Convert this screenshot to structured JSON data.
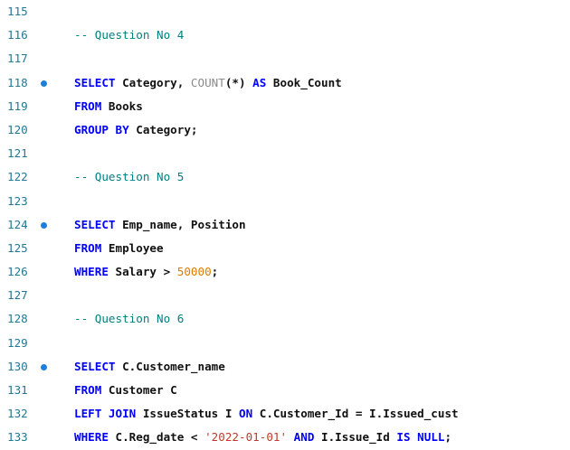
{
  "editor": {
    "lines": [
      {
        "n": "115",
        "bp": false,
        "tokens": []
      },
      {
        "n": "116",
        "bp": false,
        "tokens": [
          {
            "t": "cm",
            "v": "-- Question No 4"
          }
        ]
      },
      {
        "n": "117",
        "bp": false,
        "tokens": []
      },
      {
        "n": "118",
        "bp": true,
        "tokens": [
          {
            "t": "kw",
            "v": "SELECT"
          },
          {
            "t": "tx",
            "v": " Category, "
          },
          {
            "t": "fn",
            "v": "COUNT"
          },
          {
            "t": "tx",
            "v": "(*) "
          },
          {
            "t": "kw",
            "v": "AS"
          },
          {
            "t": "tx",
            "v": " Book_Count"
          }
        ]
      },
      {
        "n": "119",
        "bp": false,
        "tokens": [
          {
            "t": "kw",
            "v": "FROM"
          },
          {
            "t": "tx",
            "v": " Books"
          }
        ]
      },
      {
        "n": "120",
        "bp": false,
        "tokens": [
          {
            "t": "kw",
            "v": "GROUP BY"
          },
          {
            "t": "tx",
            "v": " Category;"
          }
        ]
      },
      {
        "n": "121",
        "bp": false,
        "tokens": []
      },
      {
        "n": "122",
        "bp": false,
        "tokens": [
          {
            "t": "cm",
            "v": "-- Question No 5"
          }
        ]
      },
      {
        "n": "123",
        "bp": false,
        "tokens": []
      },
      {
        "n": "124",
        "bp": true,
        "tokens": [
          {
            "t": "kw",
            "v": "SELECT"
          },
          {
            "t": "tx",
            "v": " Emp_name, Position"
          }
        ]
      },
      {
        "n": "125",
        "bp": false,
        "tokens": [
          {
            "t": "kw",
            "v": "FROM"
          },
          {
            "t": "tx",
            "v": " Employee"
          }
        ]
      },
      {
        "n": "126",
        "bp": false,
        "tokens": [
          {
            "t": "kw",
            "v": "WHERE"
          },
          {
            "t": "tx",
            "v": " Salary > "
          },
          {
            "t": "num",
            "v": "50000"
          },
          {
            "t": "tx",
            "v": ";"
          }
        ]
      },
      {
        "n": "127",
        "bp": false,
        "tokens": []
      },
      {
        "n": "128",
        "bp": false,
        "tokens": [
          {
            "t": "cm",
            "v": "-- Question No 6"
          }
        ]
      },
      {
        "n": "129",
        "bp": false,
        "tokens": []
      },
      {
        "n": "130",
        "bp": true,
        "tokens": [
          {
            "t": "kw",
            "v": "SELECT"
          },
          {
            "t": "tx",
            "v": " C.Customer_name"
          }
        ]
      },
      {
        "n": "131",
        "bp": false,
        "tokens": [
          {
            "t": "kw",
            "v": "FROM"
          },
          {
            "t": "tx",
            "v": " Customer C"
          }
        ]
      },
      {
        "n": "132",
        "bp": false,
        "tokens": [
          {
            "t": "kw",
            "v": "LEFT JOIN"
          },
          {
            "t": "tx",
            "v": " IssueStatus I "
          },
          {
            "t": "kw",
            "v": "ON"
          },
          {
            "t": "tx",
            "v": " C.Customer_Id = I.Issued_cust"
          }
        ]
      },
      {
        "n": "133",
        "bp": false,
        "tokens": [
          {
            "t": "kw",
            "v": "WHERE"
          },
          {
            "t": "tx",
            "v": " C.Reg_date < "
          },
          {
            "t": "str",
            "v": "'2022-01-01'"
          },
          {
            "t": "tx",
            "v": " "
          },
          {
            "t": "kw",
            "v": "AND"
          },
          {
            "t": "tx",
            "v": " I.Issue_Id "
          },
          {
            "t": "kw",
            "v": "IS NULL"
          },
          {
            "t": "tx",
            "v": ";"
          }
        ]
      }
    ]
  }
}
